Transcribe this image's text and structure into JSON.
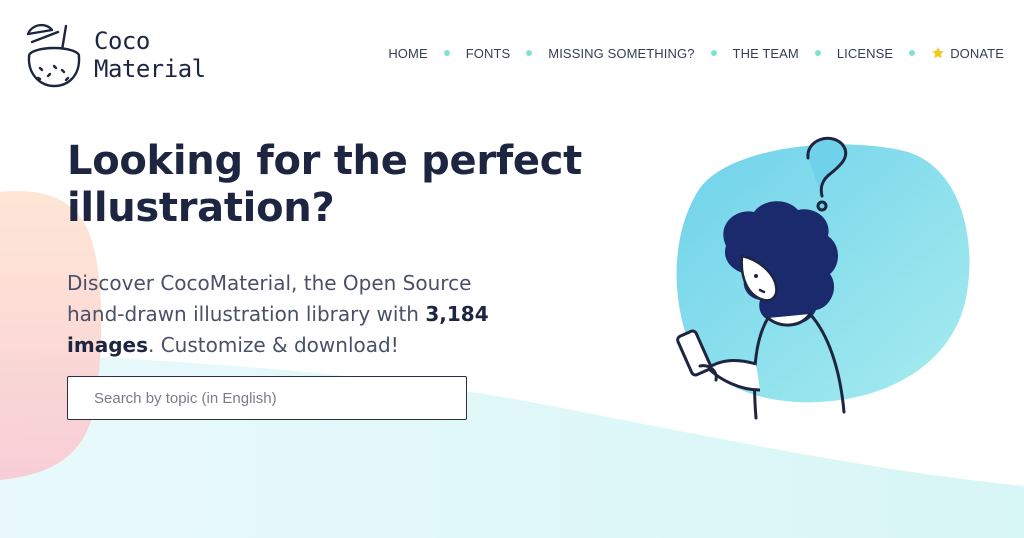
{
  "brand": {
    "line1": "Coco",
    "line2": "Material"
  },
  "nav": {
    "items": [
      {
        "label": "HOME"
      },
      {
        "label": "FONTS"
      },
      {
        "label": "MISSING SOMETHING?"
      },
      {
        "label": "THE TEAM"
      },
      {
        "label": "LICENSE"
      },
      {
        "label": "DONATE",
        "icon": "star-icon"
      }
    ]
  },
  "hero": {
    "headline": "Looking for the perfect illustration?",
    "lead_before": "Discover CocoMaterial, the Open Source hand-drawn illustration library with ",
    "lead_count": "3,184",
    "lead_images": "images",
    "lead_after": ". Customize & download!"
  },
  "search": {
    "placeholder": "Search by topic (in English)",
    "value": ""
  },
  "colors": {
    "accent_dot": "#7fe3d2",
    "star": "#f5c518",
    "blob": "#7ad8ea",
    "text_dark": "#1d2540"
  }
}
